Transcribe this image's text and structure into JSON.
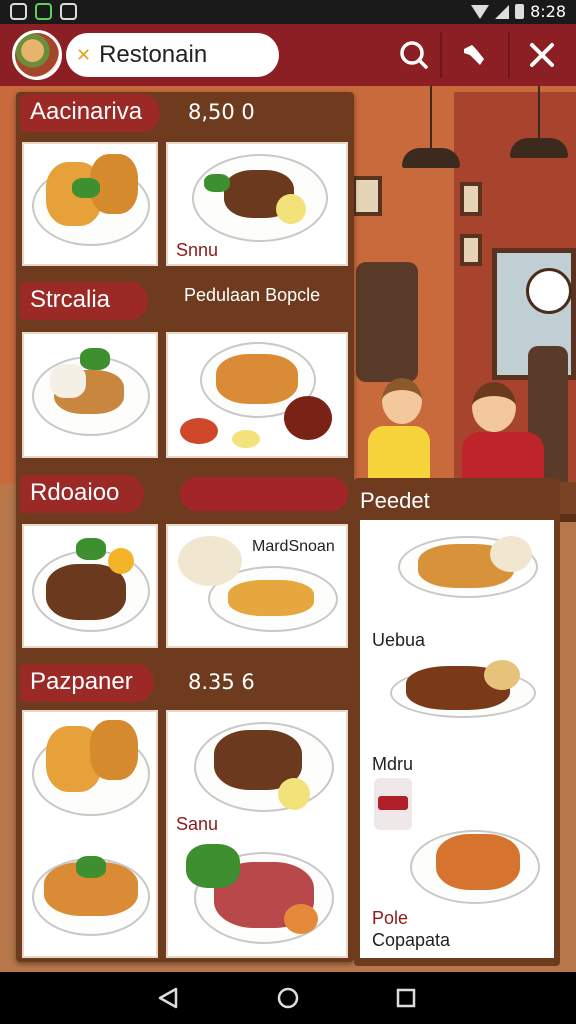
{
  "status_bar": {
    "time": "8:28"
  },
  "app_bar": {
    "title": "Restonain",
    "icons": [
      "search-icon",
      "wrench-icon",
      "close-icon"
    ]
  },
  "sections": [
    {
      "title": "Aacinariva",
      "price": "8,50 0"
    },
    {
      "title": "Strcalia",
      "sub": "Pedulaan Bopcle"
    },
    {
      "title": "Rdoaioo"
    },
    {
      "title": "Pazpaner",
      "price": "8.35 6"
    }
  ],
  "cards": {
    "c2_label": "Snnu",
    "c6_label": "MardSnoan",
    "c8_label": "Sanu"
  },
  "panel": {
    "title": "Peedet",
    "labels": [
      "Uebua",
      "Mdru",
      "Pole",
      "Copapata"
    ]
  },
  "colors": {
    "accent": "#8c1f24",
    "board": "#6e3b1f"
  }
}
